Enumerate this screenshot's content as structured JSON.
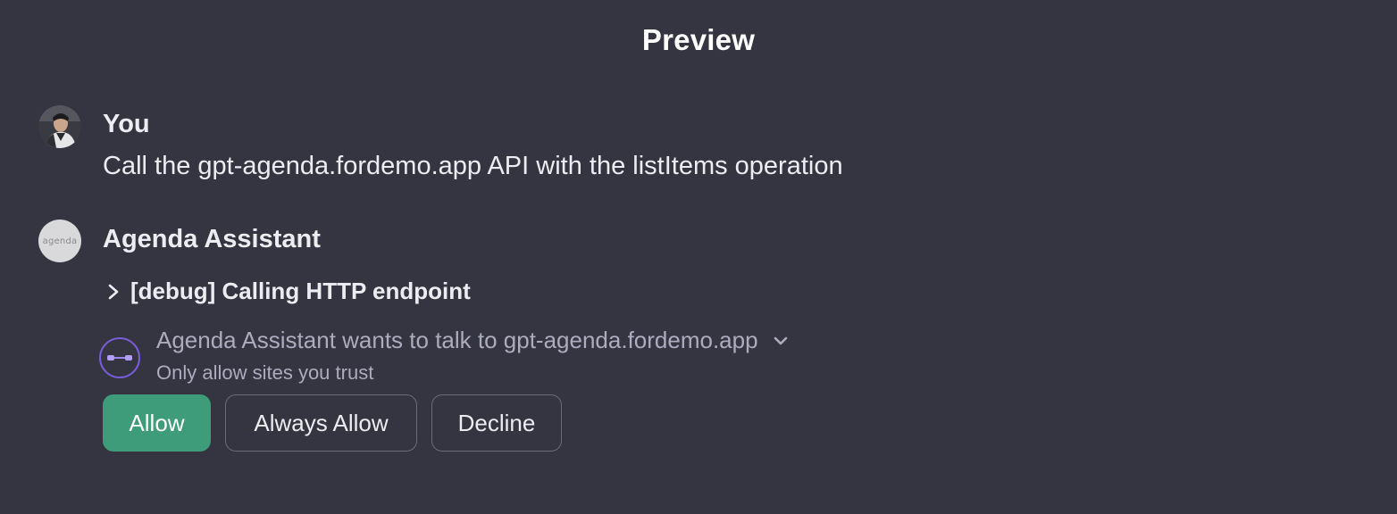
{
  "header": {
    "title": "Preview"
  },
  "conversation": {
    "user": {
      "name": "You",
      "avatar_icon": "user-photo-avatar",
      "message": "Call the gpt-agenda.fordemo.app API with the listItems operation"
    },
    "assistant": {
      "name": "Agenda Assistant",
      "avatar_text": "agenda",
      "debug_label": "[debug] Calling HTTP endpoint",
      "debug_icon": "chevron-right-icon",
      "permission": {
        "icon": "link-icon",
        "icon_color": "#7a5dd8",
        "request_text": "Agenda Assistant wants to talk to gpt-agenda.fordemo.app",
        "expand_icon": "chevron-down-icon",
        "warning_text": "Only allow sites you trust"
      }
    }
  },
  "actions": {
    "allow_label": "Allow",
    "always_allow_label": "Always Allow",
    "decline_label": "Decline",
    "allow_color": "#3f9c7a"
  },
  "colors": {
    "background": "#343541",
    "text": "#ececf1",
    "muted_text": "#acacbe"
  }
}
